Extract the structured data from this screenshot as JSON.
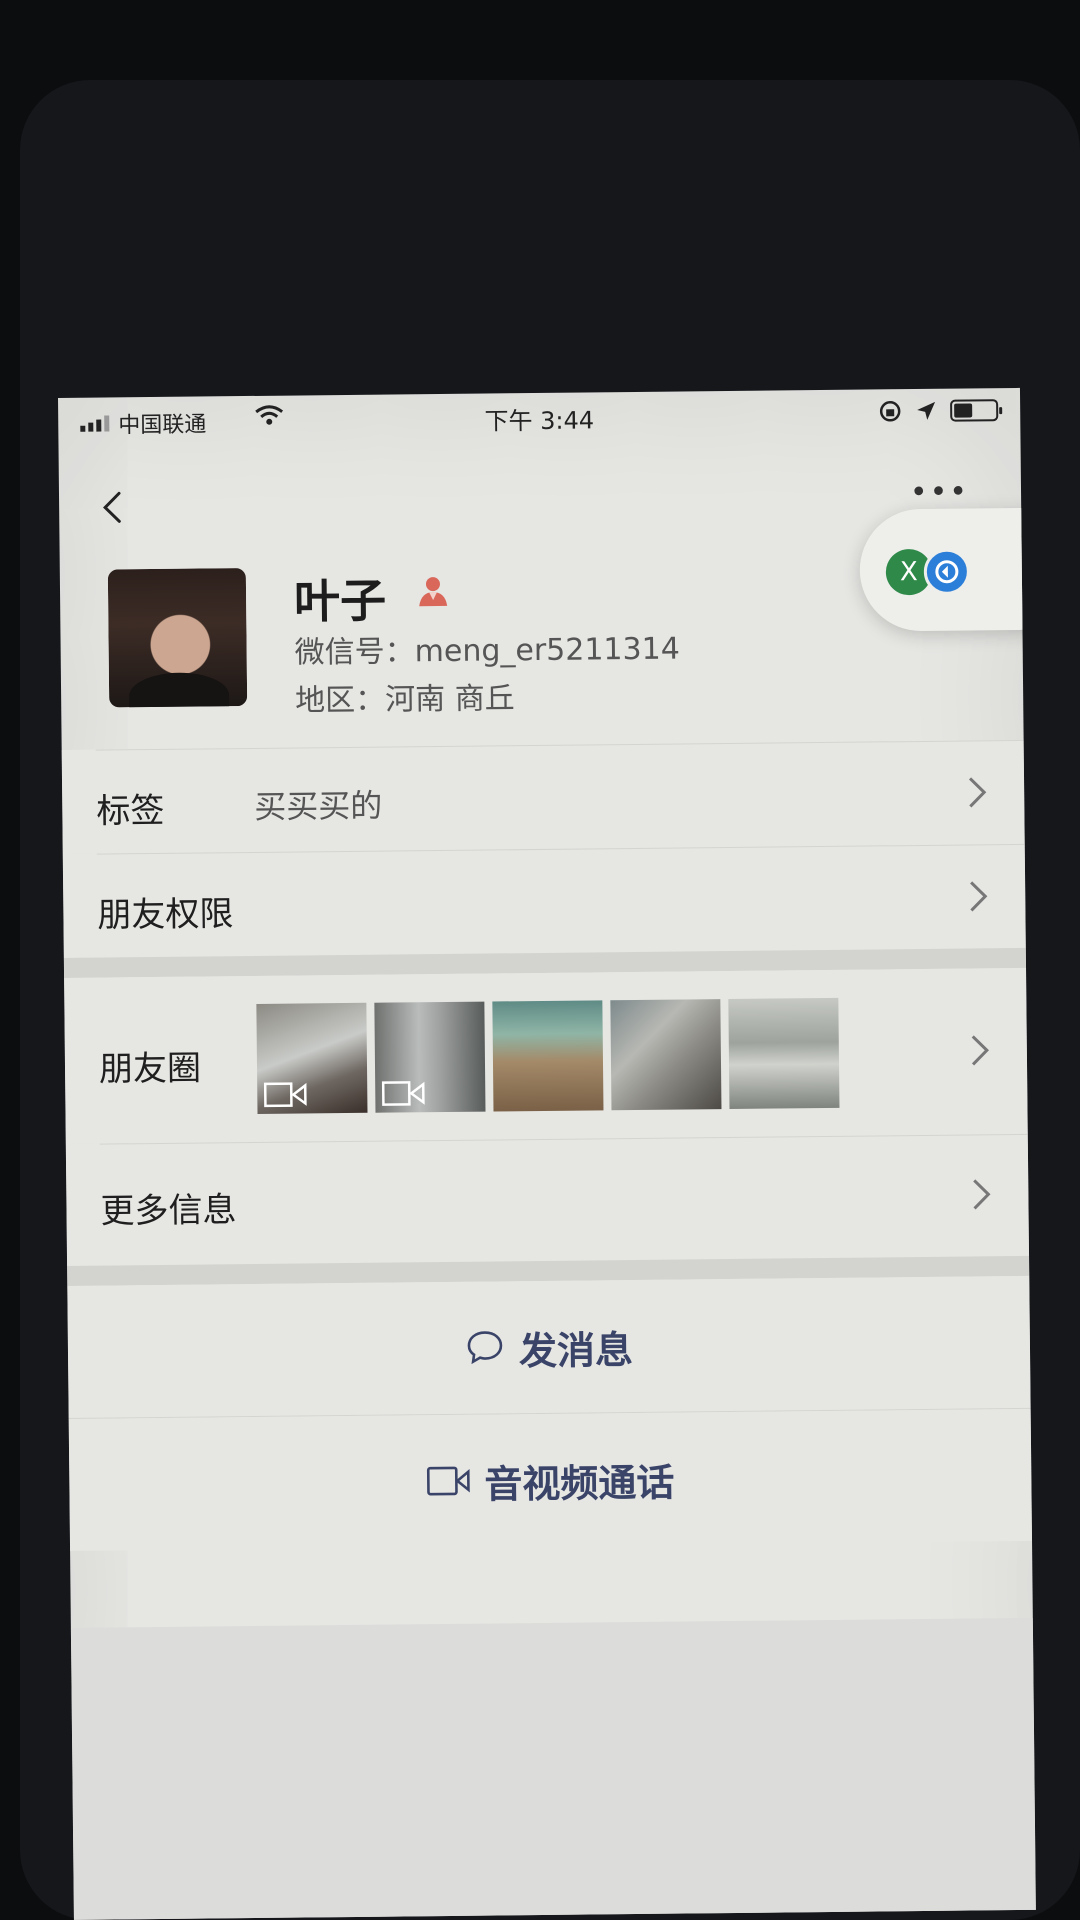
{
  "status_bar": {
    "carrier": "中国联通",
    "time": "下午 3:44"
  },
  "profile": {
    "name": "叶子",
    "wechat_id": "微信号：meng_er5211314",
    "region": "地区：河南 商丘"
  },
  "rows": {
    "tags": {
      "label": "标签",
      "value": "买买买的"
    },
    "permissions": {
      "label": "朋友权限"
    },
    "moments": {
      "label": "朋友圈"
    },
    "more_info": {
      "label": "更多信息"
    }
  },
  "actions": {
    "send_message": "发消息",
    "video_call": "音视频通话"
  },
  "floating_bubble": {
    "left_glyph": "X"
  },
  "colors": {
    "action_text": "#3a4468",
    "person_icon": "#d9685a",
    "bubble_green": "#2f8a4a",
    "bubble_blue": "#2c7fd9"
  },
  "icons": {
    "back": "chevron-left-icon",
    "more": "more-dots-icon",
    "person": "person-icon",
    "row_arrow": "chevron-right-icon",
    "message": "chat-bubble-icon",
    "video": "video-camera-icon"
  }
}
